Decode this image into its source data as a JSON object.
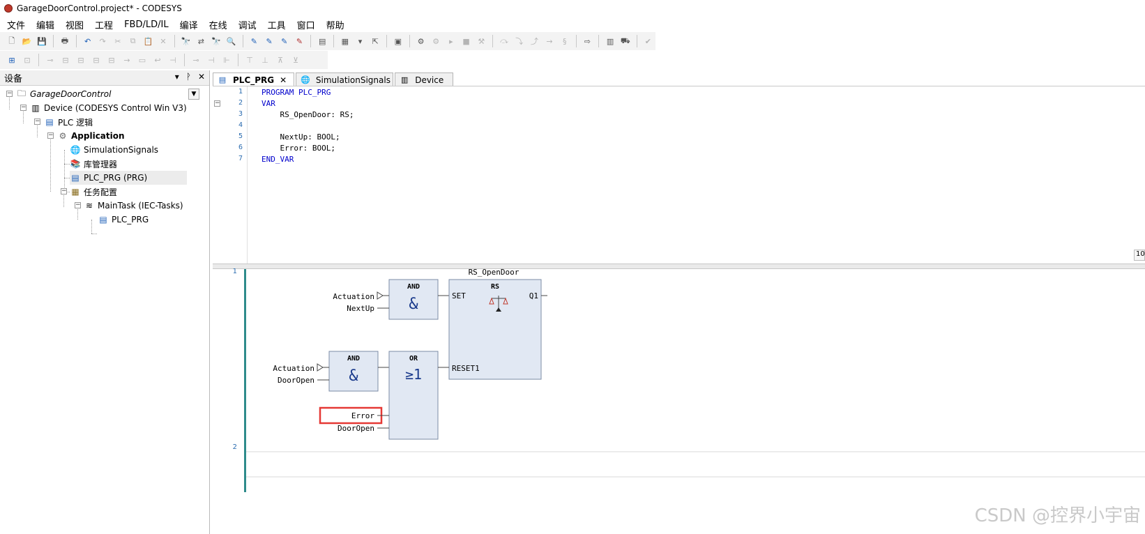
{
  "window": {
    "title": "GarageDoorControl.project* - CODESYS"
  },
  "menubar": {
    "items": [
      "文件",
      "编辑",
      "视图",
      "工程",
      "FBD/LD/IL",
      "编译",
      "在线",
      "调试",
      "工具",
      "窗口",
      "帮助"
    ]
  },
  "devices_pane": {
    "title": "设备",
    "tree": [
      {
        "label": "GarageDoorControl",
        "icon": "project-icon"
      },
      {
        "label": "Device (CODESYS Control Win V3)",
        "icon": "device-icon"
      },
      {
        "label": "PLC 逻辑",
        "icon": "plc-logic-icon"
      },
      {
        "label": "Application",
        "icon": "application-gear-icon"
      },
      {
        "label": "SimulationSignals",
        "icon": "globe-icon"
      },
      {
        "label": "库管理器",
        "icon": "library-books-icon"
      },
      {
        "label": "PLC_PRG (PRG)",
        "icon": "program-icon"
      },
      {
        "label": "任务配置",
        "icon": "task-config-icon"
      },
      {
        "label": "MainTask (IEC-Tasks)",
        "icon": "task-stack-icon"
      },
      {
        "label": "PLC_PRG",
        "icon": "program-call-icon"
      }
    ]
  },
  "tabs": [
    {
      "label": "PLC_PRG",
      "active": true,
      "icon": "program-icon"
    },
    {
      "label": "SimulationSignals",
      "active": false,
      "icon": "globe-icon"
    },
    {
      "label": "Device",
      "active": false,
      "icon": "device-icon"
    }
  ],
  "declaration": {
    "lines": [
      {
        "no": "1",
        "text": "PROGRAM PLC_PRG"
      },
      {
        "no": "2",
        "text": "VAR"
      },
      {
        "no": "3",
        "text": "    RS_OpenDoor: RS;"
      },
      {
        "no": "4",
        "text": ""
      },
      {
        "no": "5",
        "text": "    NextUp: BOOL;"
      },
      {
        "no": "6",
        "text": "    Error: BOOL;"
      },
      {
        "no": "7",
        "text": "END_VAR"
      }
    ]
  },
  "zoom_label": "10",
  "fbd": {
    "networks": [
      "1",
      "2"
    ],
    "instance_name": "RS_OpenDoor",
    "and1": {
      "title": "AND",
      "symbol": "&",
      "inputs": [
        "Actuation",
        "NextUp"
      ]
    },
    "and2": {
      "title": "AND",
      "symbol": "&",
      "inputs": [
        "Actuation",
        "DoorOpen"
      ]
    },
    "or1": {
      "title": "OR",
      "symbol": "≥1",
      "inputs": [
        "Error",
        "DoorOpen"
      ]
    },
    "rs": {
      "title": "RS",
      "pin_set": "SET",
      "pin_reset": "RESET1",
      "pin_out": "Q1"
    },
    "highlight_color": "#e53935"
  },
  "watermark": "CSDN @控界小宇宙"
}
